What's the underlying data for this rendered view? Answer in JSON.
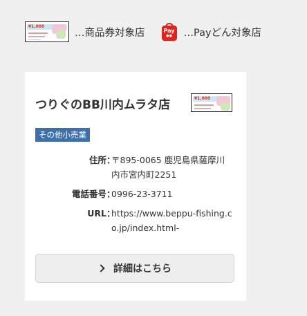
{
  "legend": {
    "voucher_label": "…商品券対象店",
    "paydon_label": "…Payどん対象店",
    "paydon_icon_text": "Pay",
    "voucher_icon_amount": "¥1,000"
  },
  "shop": {
    "name": "つりぐのBB川内ムラタ店",
    "category": "その他小売業",
    "address_label": "住所",
    "address": "〒895-0065 鹿児島県薩摩川内市宮内町2251",
    "phone_label": "電話番号",
    "phone": "0996-23-3711",
    "url_label": "URL",
    "url": "https://www.beppu-fishing.co.jp/index.html-",
    "separator": "：",
    "detail_button": "詳細はこちら"
  },
  "colors": {
    "tag_bg": "#3d6fa8",
    "paydon_red": "#e2231a"
  }
}
